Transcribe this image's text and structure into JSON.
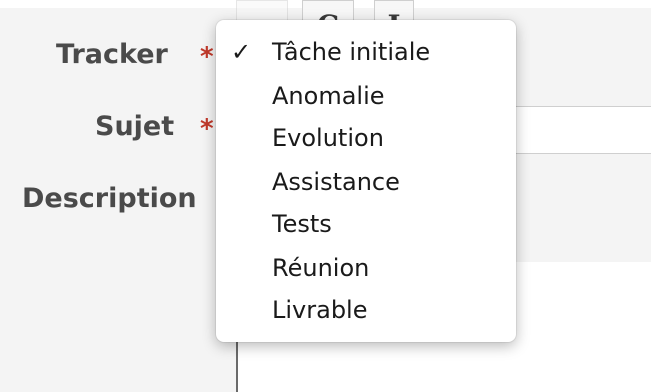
{
  "form": {
    "tracker_label": "Tracker",
    "subject_label": "Sujet",
    "description_label": "Description",
    "required_mark": "*",
    "toolbar": {
      "button_c": "C",
      "button_partial": "I"
    }
  },
  "tracker_menu": {
    "selected_mark": "✓",
    "options": [
      {
        "label": "Tâche initiale",
        "selected": true
      },
      {
        "label": "Anomalie",
        "selected": false
      },
      {
        "label": "Evolution",
        "selected": false
      },
      {
        "label": "Assistance",
        "selected": false
      },
      {
        "label": "Tests",
        "selected": false
      },
      {
        "label": "Réunion",
        "selected": false
      },
      {
        "label": "Livrable",
        "selected": false
      }
    ]
  }
}
